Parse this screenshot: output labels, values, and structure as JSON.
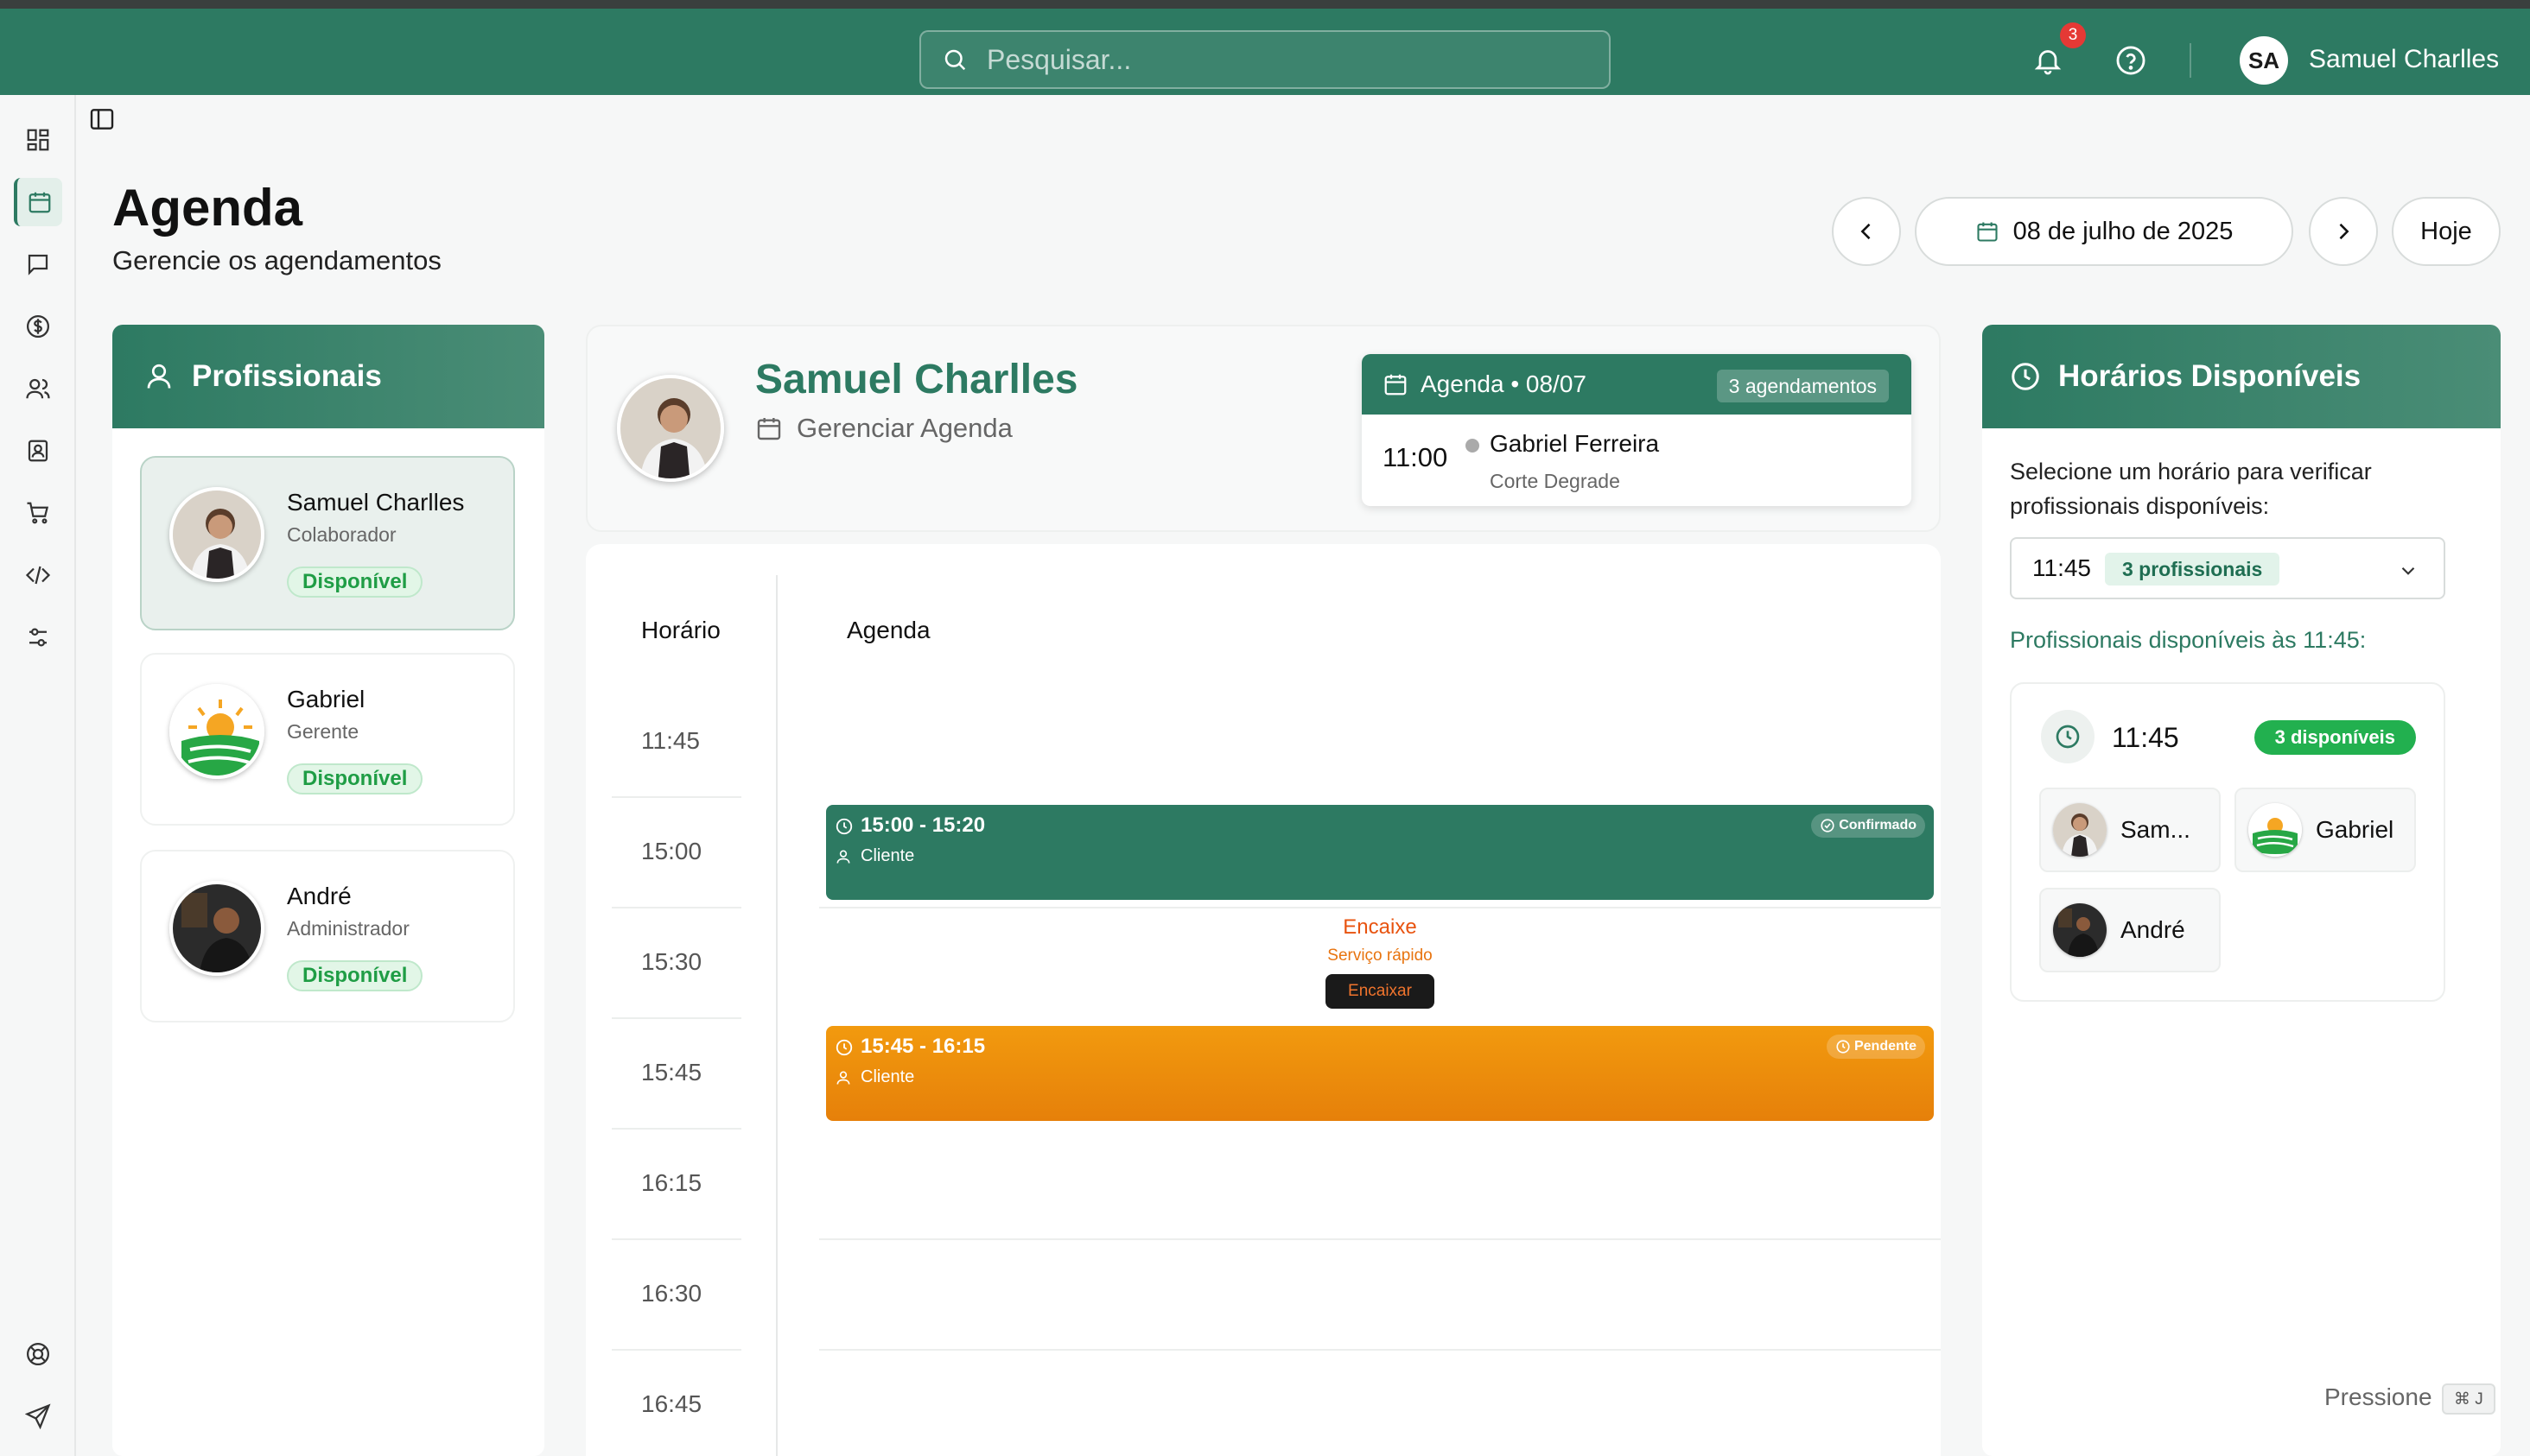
{
  "topbar": {
    "search_placeholder": "Pesquisar...",
    "notification_count": "3",
    "user_initials": "SA",
    "user_name": "Samuel Charlles"
  },
  "header": {
    "title": "Agenda",
    "subtitle": "Gerencie os agendamentos",
    "date": "08 de julho de 2025",
    "today_label": "Hoje"
  },
  "professionals": {
    "title": "Profissionais",
    "items": [
      {
        "name": "Samuel Charlles",
        "role": "Colaborador",
        "status": "Disponível"
      },
      {
        "name": "Gabriel",
        "role": "Gerente",
        "status": "Disponível"
      },
      {
        "name": "André",
        "role": "Administrador",
        "status": "Disponível"
      }
    ]
  },
  "selected": {
    "name": "Samuel Charlles",
    "manage_label": "Gerenciar Agenda",
    "agenda_label": "Agenda • 08/07",
    "agenda_count": "3 agendamentos",
    "next": {
      "time": "11:00",
      "client": "Gabriel Ferreira",
      "service": "Corte Degrade"
    }
  },
  "schedule": {
    "col_time": "Horário",
    "col_agenda": "Agenda",
    "slots": [
      "11:45",
      "15:00",
      "15:30",
      "15:45",
      "16:15",
      "16:30",
      "16:45"
    ],
    "appointments": [
      {
        "time": "15:00 - 15:20",
        "client": "Cliente",
        "status": "Confirmado"
      },
      {
        "time": "15:45 - 16:15",
        "client": "Cliente",
        "status": "Pendente"
      }
    ],
    "encaixe": {
      "title": "Encaixe",
      "subtitle": "Serviço rápido",
      "button": "Encaixar"
    }
  },
  "availability": {
    "title": "Horários Disponíveis",
    "instruction": "Selecione um horário para verificar profissionais disponíveis:",
    "selected_time": "11:45",
    "selected_badge": "3 profissionais",
    "available_title": "Profissionais disponíveis às 11:45:",
    "box_time": "11:45",
    "box_count": "3 disponíveis",
    "chips": [
      "Sam...",
      "Gabriel",
      "André"
    ]
  },
  "shortcut": {
    "label": "Pressione",
    "key": "⌘ J"
  },
  "colors": {
    "primary": "#2d7a62",
    "available": "#22b04f",
    "pending": "#f29a0e",
    "encaixe": "#e8530f"
  }
}
